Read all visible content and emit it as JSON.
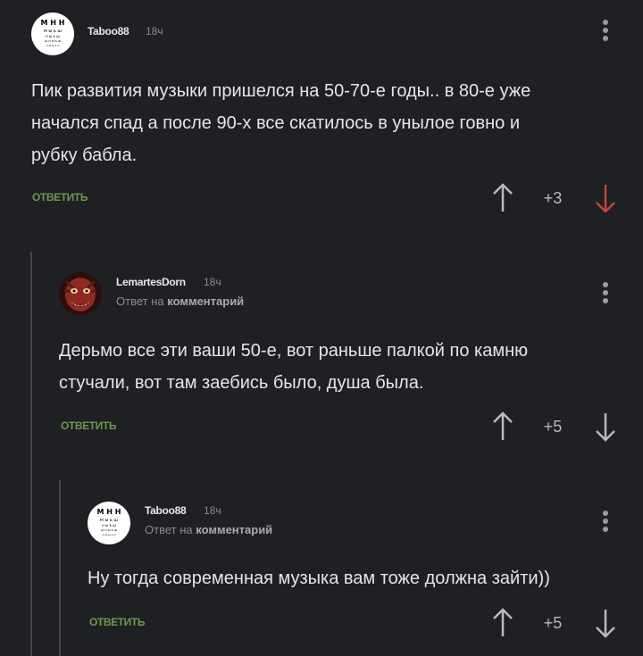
{
  "colors": {
    "background": "#1f2023",
    "reply_green": "#6a9a4e",
    "downvote_active": "#c0443a",
    "vote_arrow": "#b8babd"
  },
  "comments": [
    {
      "username": "Taboo88",
      "time": "18ч",
      "avatar_icon": "eye-chart-avatar",
      "lines": [
        "Пик развития музыки пришелся на 50-70-е годы.. в 80-е уже",
        "начался спад а после 90-х  все скатилось в унылое говно и",
        "рубку бабла."
      ],
      "reply_label": "ОТВЕТИТЬ",
      "rating": "+3",
      "downvoted": true
    },
    {
      "username": "LemartesDorn",
      "time": "18ч",
      "avatar_icon": "demon-face-avatar",
      "reply_to_prefix": "Ответ на",
      "reply_to_target": "комментарий",
      "lines": [
        "Дерьмо все эти ваши 50-е, вот раньше палкой по камню",
        "стучали, вот там заебись было, душа была."
      ],
      "reply_label": "ОТВЕТИТЬ",
      "rating": "+5",
      "downvoted": false
    },
    {
      "username": "Taboo88",
      "time": "18ч",
      "avatar_icon": "eye-chart-avatar",
      "reply_to_prefix": "Ответ на",
      "reply_to_target": "комментарий",
      "lines": [
        "Ну тогда современная музыка вам тоже должна зайти))"
      ],
      "reply_label": "ОТВЕТИТЬ",
      "rating": "+5",
      "downvoted": false
    }
  ]
}
